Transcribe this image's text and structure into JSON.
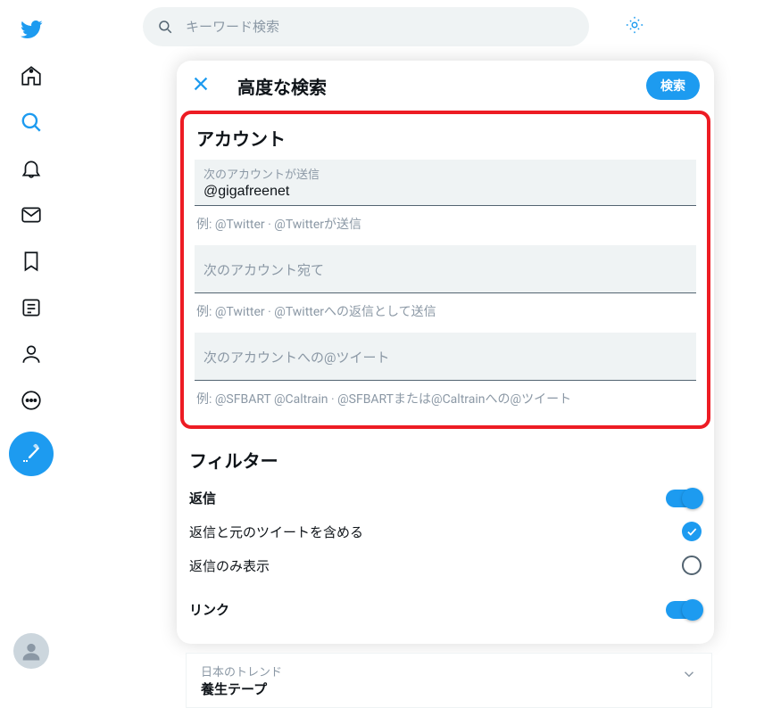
{
  "search": {
    "placeholder": "キーワード検索"
  },
  "modal": {
    "title": "高度な検索",
    "search_button": "検索",
    "account_heading": "アカウント",
    "from_label": "次のアカウントが送信",
    "from_value": "@gigafreenet",
    "from_hint": "例: @Twitter · @Twitterが送信",
    "to_label": "次のアカウント宛て",
    "to_hint": "例: @Twitter · @Twitterへの返信として送信",
    "mention_label": "次のアカウントへの@ツイート",
    "mention_hint": "例: @SFBART @Caltrain · @SFBARTまたは@Caltrainへの@ツイート",
    "filter_heading": "フィルター",
    "replies_label": "返信",
    "include_replies_label": "返信と元のツイートを含める",
    "only_replies_label": "返信のみ表示",
    "links_label": "リンク"
  },
  "trend": {
    "small": "日本のトレンド",
    "title": "養生テープ"
  },
  "colors": {
    "primary": "#1d9bf0",
    "highlight": "#ed1c24"
  }
}
